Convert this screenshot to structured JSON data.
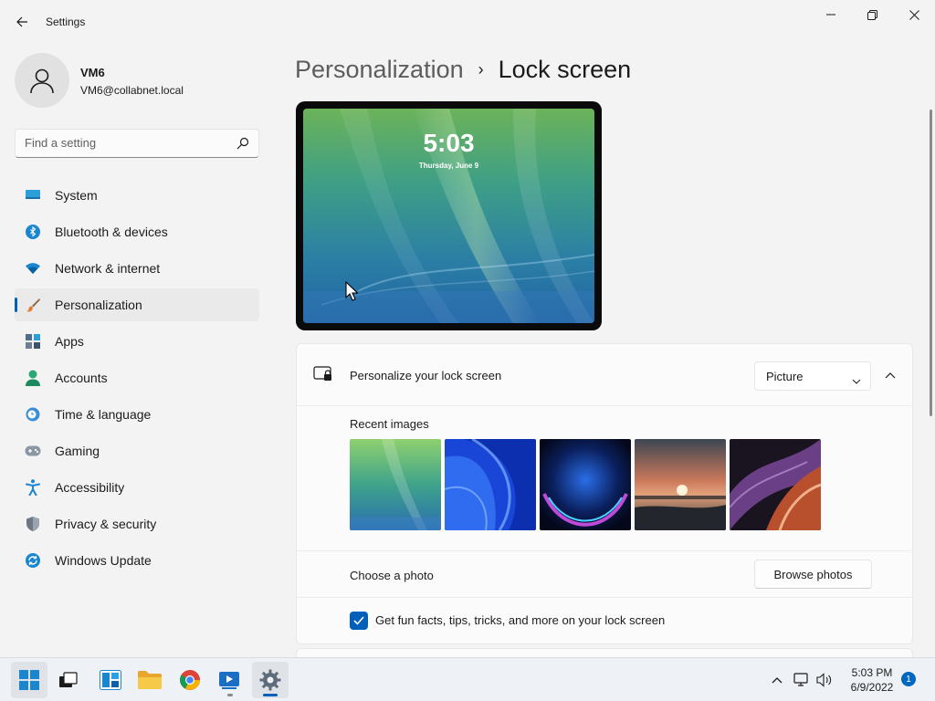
{
  "window": {
    "title": "Settings",
    "controls": [
      "minimize",
      "maximize",
      "close"
    ]
  },
  "user": {
    "name": "VM6",
    "email": "VM6@collabnet.local"
  },
  "search": {
    "placeholder": "Find a setting",
    "icon": "search-icon"
  },
  "sidebar": {
    "items": [
      {
        "label": "System",
        "icon": "system-icon",
        "active": false
      },
      {
        "label": "Bluetooth & devices",
        "icon": "bluetooth-icon",
        "active": false
      },
      {
        "label": "Network & internet",
        "icon": "wifi-icon",
        "active": false
      },
      {
        "label": "Personalization",
        "icon": "brush-icon",
        "active": true
      },
      {
        "label": "Apps",
        "icon": "apps-icon",
        "active": false
      },
      {
        "label": "Accounts",
        "icon": "accounts-icon",
        "active": false
      },
      {
        "label": "Time & language",
        "icon": "time-language-icon",
        "active": false
      },
      {
        "label": "Gaming",
        "icon": "gaming-icon",
        "active": false
      },
      {
        "label": "Accessibility",
        "icon": "accessibility-icon",
        "active": false
      },
      {
        "label": "Privacy & security",
        "icon": "shield-icon",
        "active": false
      },
      {
        "label": "Windows Update",
        "icon": "windows-update-icon",
        "active": false
      }
    ]
  },
  "breadcrumb": {
    "parent": "Personalization",
    "separator": "›",
    "current": "Lock screen"
  },
  "preview": {
    "time": "5:03",
    "date": "Thursday, June 9"
  },
  "lock_screen": {
    "personalize_label": "Personalize your lock screen",
    "dropdown_value": "Picture",
    "recent_images_label": "Recent images",
    "recent_images": [
      "green-aurora",
      "blue-bloom",
      "dark-glow",
      "sunset-lake",
      "purple-ribbon"
    ],
    "choose_photo_label": "Choose a photo",
    "browse_button": "Browse photos",
    "fun_facts_label": "Get fun facts, tips, tricks, and more on your lock screen",
    "fun_facts_checked": true
  },
  "taskbar": {
    "apps": [
      "start",
      "task-view",
      "widgets",
      "file-explorer",
      "chrome",
      "media-player",
      "settings"
    ],
    "clock_time": "5:03 PM",
    "clock_date": "6/9/2022",
    "notification_count": "1"
  },
  "colors": {
    "accent": "#005fb8",
    "background": "#f3f3f3",
    "card": "#fbfbfb"
  }
}
